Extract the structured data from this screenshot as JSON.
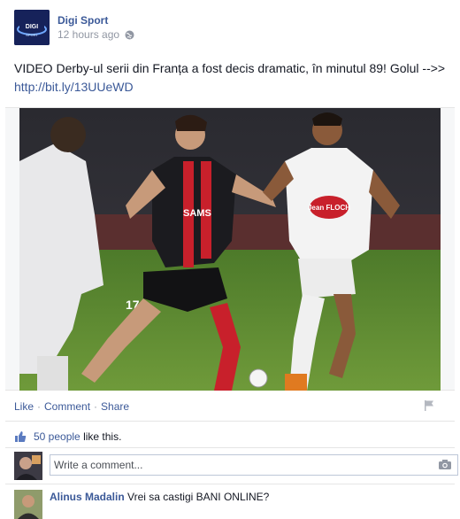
{
  "post": {
    "author": "Digi Sport",
    "timestamp": "12 hours ago",
    "text": "VIDEO Derby-ul serii din Franța a fost decis dramatic, în minutul 89! Golul -->> ",
    "link": "http://bit.ly/13UUeWD",
    "photo": {
      "shirt_sponsor_left": "SAMS",
      "shirt_number_left": "17",
      "shirt_sponsor_right": "Jean FLOCH"
    }
  },
  "actions": {
    "like": "Like",
    "comment": "Comment",
    "share": "Share",
    "separator": "·"
  },
  "likes": {
    "count_text": "50 people",
    "suffix": "like this."
  },
  "comment_box": {
    "placeholder": "Write a comment..."
  },
  "comment": {
    "name": "Alinus Madalin",
    "text": "Vrei sa castigi BANI ONLINE?"
  },
  "colors": {
    "link": "#3b5998",
    "muted": "#9197a3"
  },
  "icons": {
    "privacy": "globe-icon",
    "report": "flag-icon",
    "likes": "thumb-up-icon",
    "photo_upload": "camera-icon"
  }
}
